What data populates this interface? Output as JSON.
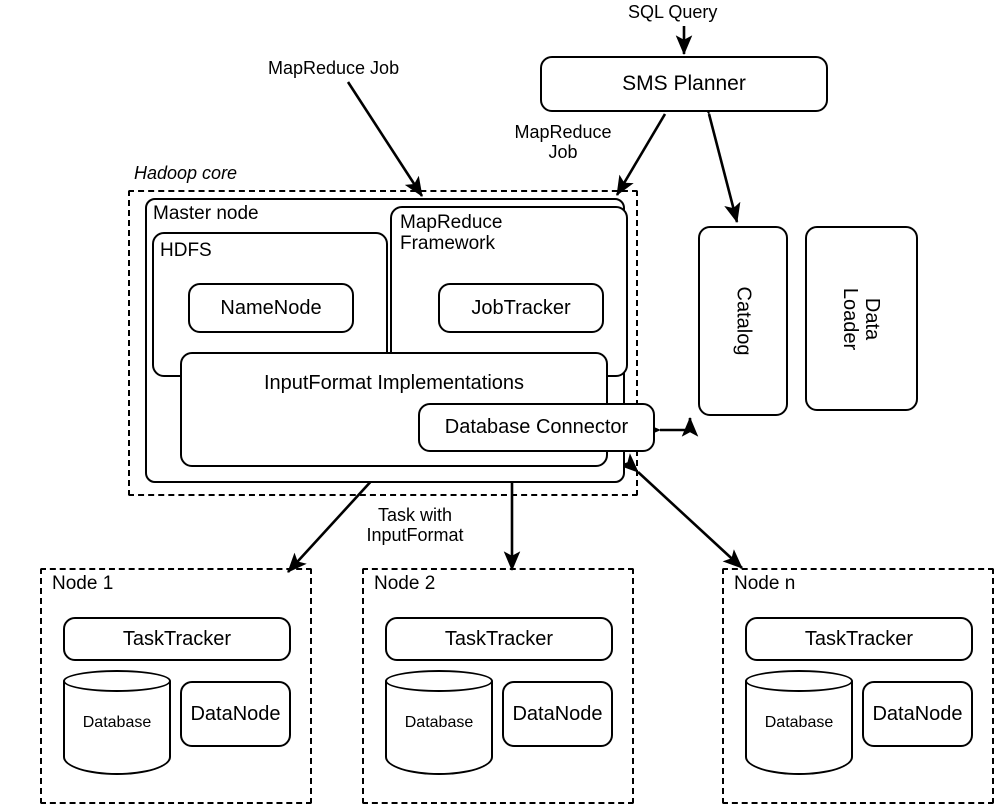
{
  "figure": {
    "kind": "architecture-diagram",
    "subject": "HadoopDB architecture"
  },
  "top": {
    "sql_query_label": "SQL Query",
    "sms_planner_label": "SMS Planner",
    "mapreduce_job_label_left": "MapReduce Job",
    "mapreduce_job_label_right": "MapReduce\nJob"
  },
  "hadoop_core": {
    "title": "Hadoop core",
    "master_node": {
      "title": "Master node",
      "hdfs": {
        "title": "HDFS",
        "namenode_label": "NameNode"
      },
      "mapreduce_framework": {
        "title": "MapReduce\nFramework",
        "jobtracker_label": "JobTracker"
      },
      "inputformat_label": "InputFormat Implementations",
      "database_connector_label": "Database Connector"
    }
  },
  "side_components": [
    {
      "label": "Catalog"
    },
    {
      "label": "Data\nLoader"
    }
  ],
  "annotations": {
    "task_with_inputformat": "Task with\nInputFormat"
  },
  "nodes": [
    {
      "title": "Node 1",
      "tasktracker_label": "TaskTracker",
      "database_label": "Database",
      "datanode_label": "DataNode"
    },
    {
      "title": "Node 2",
      "tasktracker_label": "TaskTracker",
      "database_label": "Database",
      "datanode_label": "DataNode"
    },
    {
      "title": "Node n",
      "tasktracker_label": "TaskTracker",
      "database_label": "Database",
      "datanode_label": "DataNode"
    }
  ],
  "colors": {
    "stroke": "#000000",
    "background": "#ffffff"
  }
}
